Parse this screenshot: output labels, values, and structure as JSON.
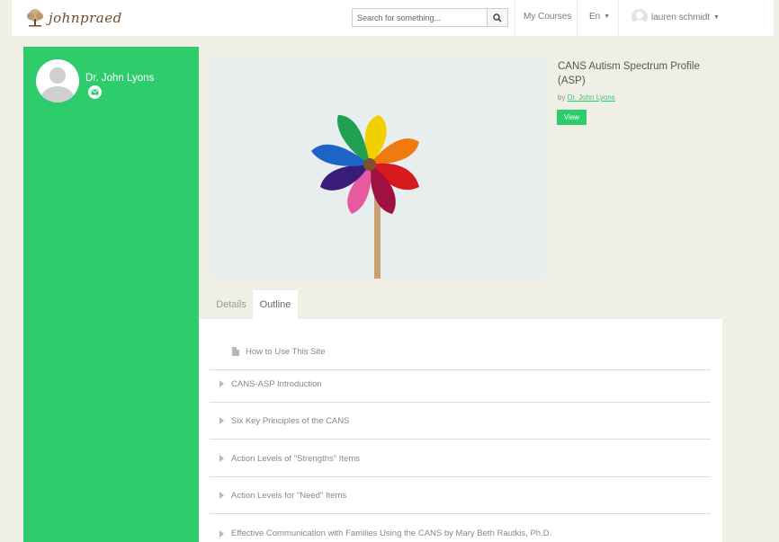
{
  "brand": {
    "logo_text": "johnpraed"
  },
  "header": {
    "search_placeholder": "Search for something...",
    "my_courses": "My Courses",
    "language": "En",
    "user_name": "lauren schmidt"
  },
  "sidebar": {
    "author_name": "Dr. John Lyons"
  },
  "course": {
    "title": "CANS Autism Spectrum Profile (ASP)",
    "by_prefix": "by",
    "author": "Dr. John Lyons",
    "view_label": "View"
  },
  "tabs": [
    {
      "label": "Details"
    },
    {
      "label": "Outline"
    }
  ],
  "outline": [
    {
      "label": "How to Use This Site",
      "icon": "document-icon"
    },
    {
      "label": "CANS-ASP Introduction",
      "icon": "expand-arrow-icon"
    },
    {
      "label": "Six Key Principles of the CANS",
      "icon": "expand-arrow-icon"
    },
    {
      "label": "Action Levels of \"Strengths\" Items",
      "icon": "expand-arrow-icon"
    },
    {
      "label": "Action Levels for \"Need\" Items",
      "icon": "expand-arrow-icon"
    },
    {
      "label": "Effective Communication with Families Using the CANS by Mary Beth Rautkis, Ph.D.",
      "icon": "expand-arrow-icon"
    }
  ],
  "colors": {
    "accent": "#2ecc6a",
    "page_bg": "#f0efe6"
  }
}
